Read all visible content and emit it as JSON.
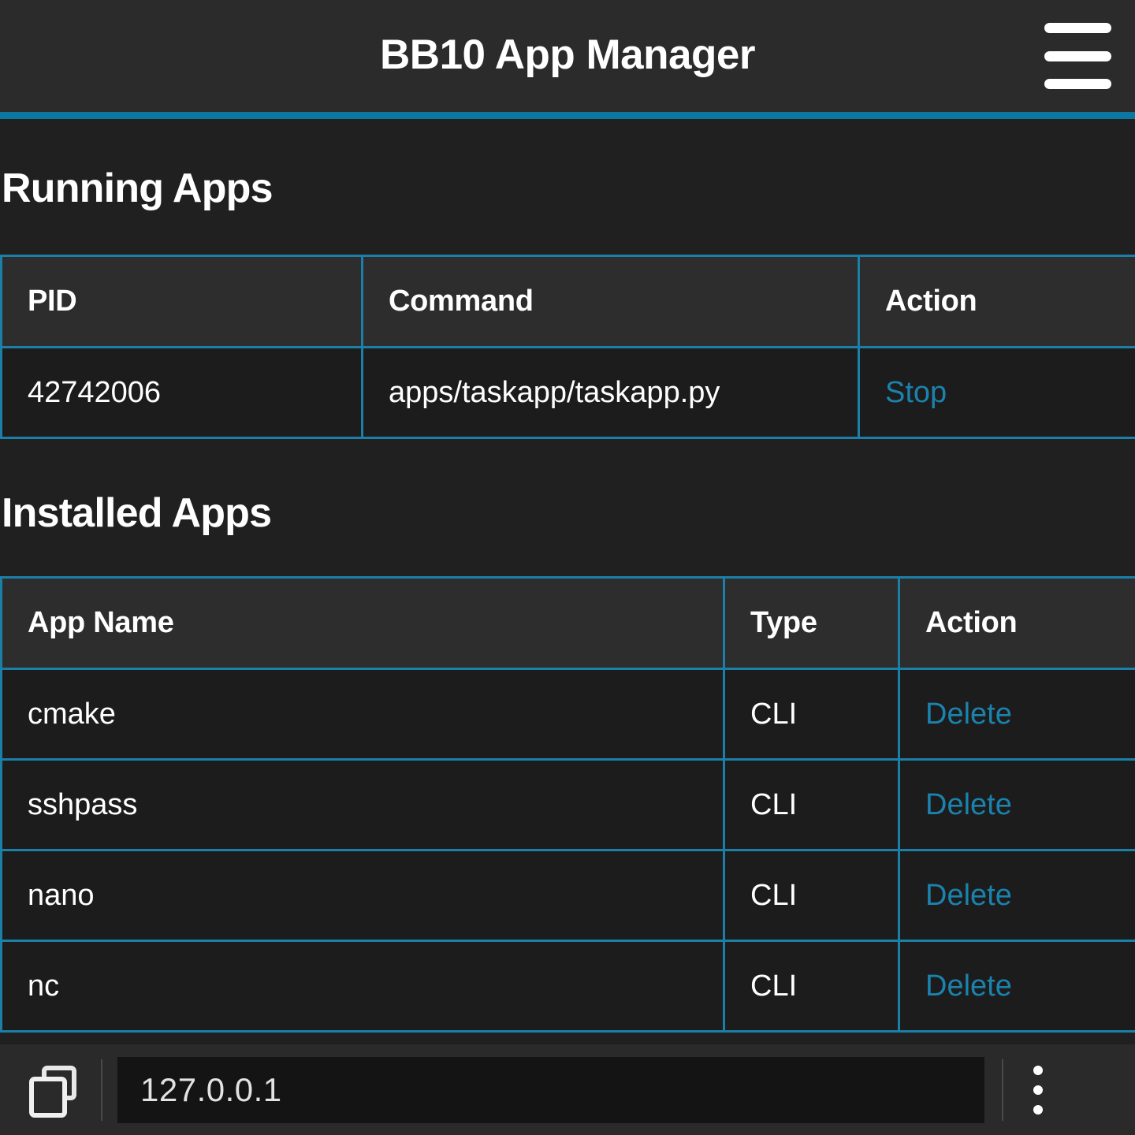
{
  "header": {
    "title": "BB10 App Manager",
    "menu_icon": "hamburger-icon",
    "accent_color": "#0d76a1",
    "background_color": "#2b2b2b"
  },
  "sections": {
    "running": {
      "title": "Running Apps",
      "columns": [
        "PID",
        "Command",
        "Action"
      ],
      "rows": [
        {
          "pid": "42742006",
          "command": "apps/taskapp/taskapp.py",
          "action": "Stop"
        }
      ]
    },
    "installed": {
      "title": "Installed Apps",
      "columns": [
        "App Name",
        "Type",
        "Action"
      ],
      "rows": [
        {
          "name": "cmake",
          "type": "CLI",
          "action": "Delete"
        },
        {
          "name": "sshpass",
          "type": "CLI",
          "action": "Delete"
        },
        {
          "name": "nano",
          "type": "CLI",
          "action": "Delete"
        },
        {
          "name": "nc",
          "type": "CLI",
          "action": "Delete"
        }
      ]
    }
  },
  "browser_bar": {
    "tabs_icon": "tabs-icon",
    "url": "127.0.0.1",
    "menu_icon": "kebab-menu-icon"
  },
  "colors": {
    "link": "#1b82ad",
    "table_border": "#1b7fa8",
    "page_background": "#202020",
    "table_header_background": "#2d2d2d",
    "table_row_background": "#1c1c1c"
  }
}
